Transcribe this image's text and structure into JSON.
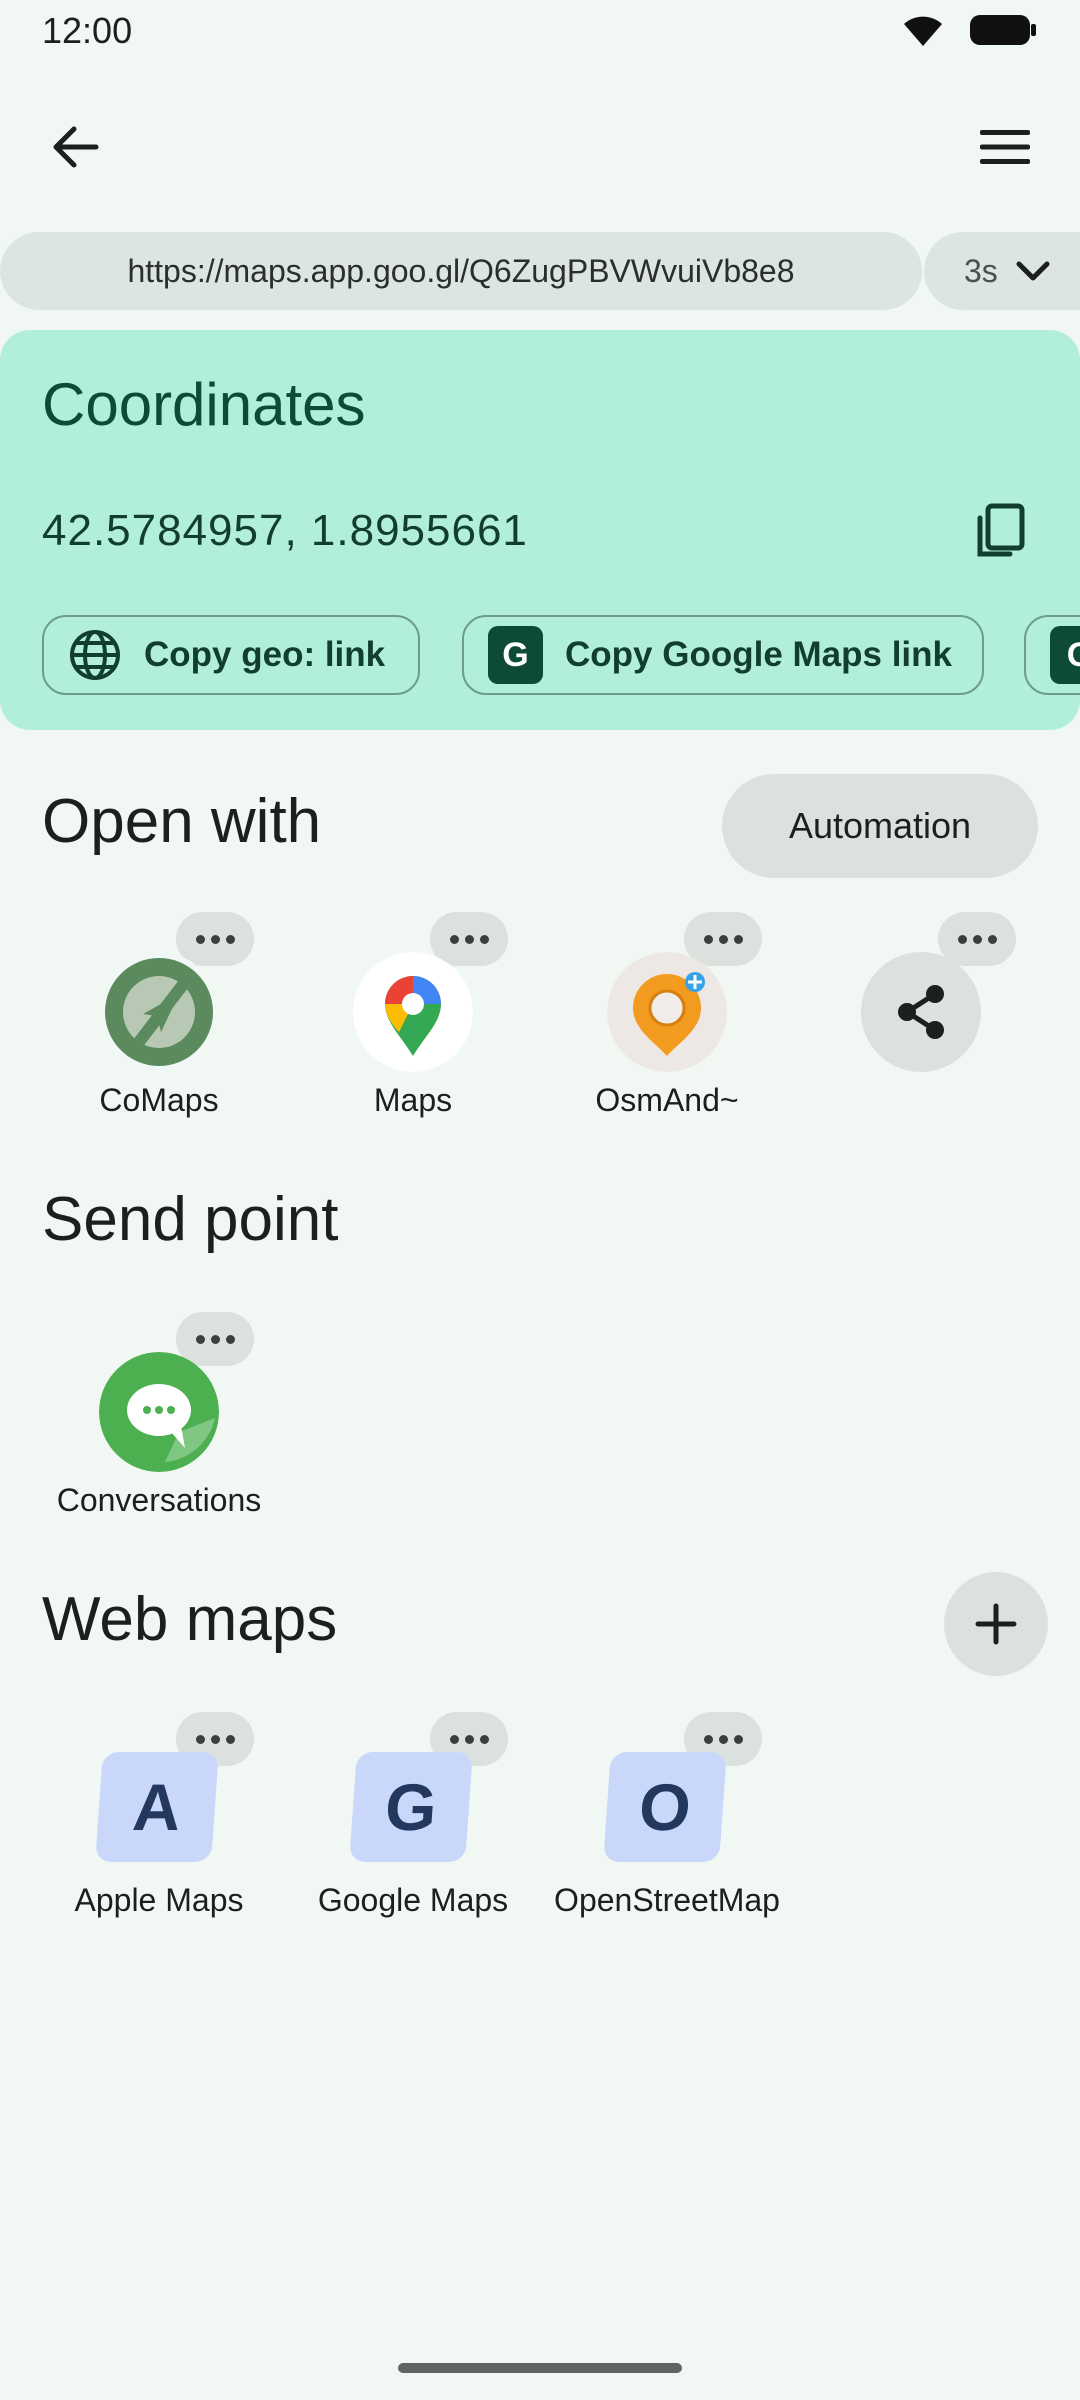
{
  "status": {
    "time": "12:00"
  },
  "url_bar": {
    "url": "https://maps.app.goo.gl/Q6ZugPBVWvuiVb8e8",
    "delay": "3s"
  },
  "coordinates": {
    "title": "Coordinates",
    "value": "42.5784957, 1.8955661",
    "chips": [
      {
        "label": "Copy geo: link",
        "icon": "globe-icon"
      },
      {
        "label": "Copy Google Maps link",
        "icon": "G"
      },
      {
        "label": "",
        "icon": "G"
      }
    ]
  },
  "open_with": {
    "title": "Open with",
    "automation_label": "Automation",
    "apps": [
      {
        "label": "CoMaps",
        "icon": "comaps-icon"
      },
      {
        "label": "Maps",
        "icon": "google-maps-pin-icon"
      },
      {
        "label": "OsmAnd~",
        "icon": "osmand-icon"
      },
      {
        "label": "",
        "icon": "share-icon"
      }
    ]
  },
  "send_point": {
    "title": "Send point",
    "apps": [
      {
        "label": "Conversations",
        "icon": "conversations-icon"
      }
    ]
  },
  "web_maps": {
    "title": "Web maps",
    "apps": [
      {
        "label": "Apple Maps",
        "letter": "A"
      },
      {
        "label": "Google Maps",
        "letter": "G"
      },
      {
        "label": "OpenStreetMap",
        "letter": "O"
      }
    ]
  },
  "colors": {
    "background": "#f1f8f4",
    "card": "#b2efdb",
    "accent_dark": "#0d4a38",
    "chip_surface": "#dbe2de"
  }
}
